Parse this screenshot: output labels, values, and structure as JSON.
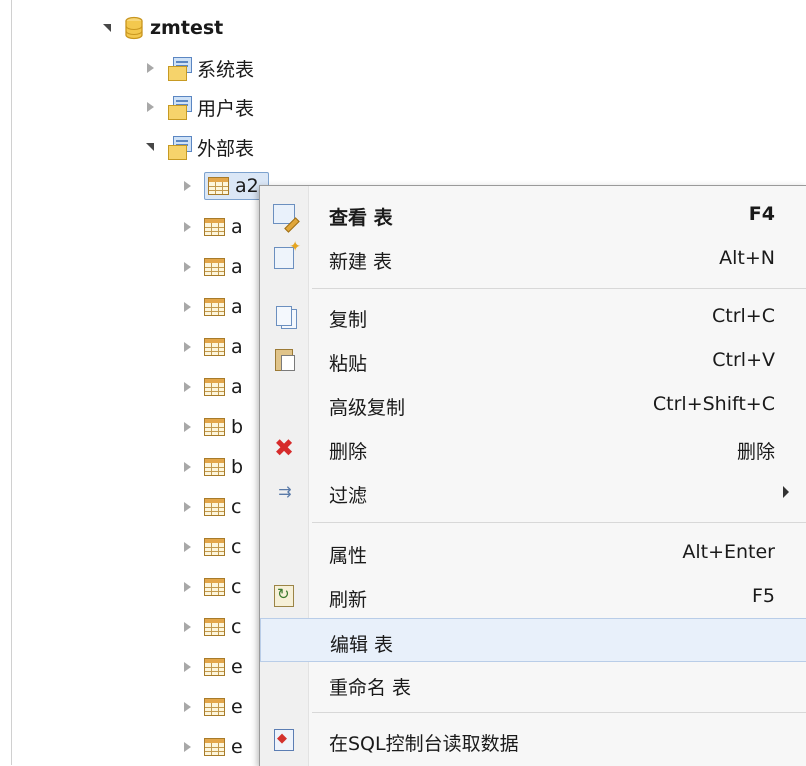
{
  "tree": {
    "database": {
      "label": "zmtest"
    },
    "folders": [
      {
        "label": "系统表",
        "expanded": false
      },
      {
        "label": "用户表",
        "expanded": false
      },
      {
        "label": "外部表",
        "expanded": true
      }
    ],
    "tables": [
      {
        "label": "a2",
        "selected": true
      },
      {
        "label": "a"
      },
      {
        "label": "a"
      },
      {
        "label": "a"
      },
      {
        "label": "a"
      },
      {
        "label": "a"
      },
      {
        "label": "b"
      },
      {
        "label": "b"
      },
      {
        "label": "c"
      },
      {
        "label": "c"
      },
      {
        "label": "c"
      },
      {
        "label": "c"
      },
      {
        "label": "e"
      },
      {
        "label": "e"
      },
      {
        "label": "e"
      }
    ]
  },
  "context_menu": {
    "items": [
      {
        "label": "查看 表",
        "accel": "F4",
        "icon": "view-table-icon"
      },
      {
        "label": "新建 表",
        "accel": "Alt+N",
        "icon": "new-table-icon"
      },
      {
        "label": "复制",
        "accel": "Ctrl+C",
        "icon": "copy-icon"
      },
      {
        "label": "粘贴",
        "accel": "Ctrl+V",
        "icon": "paste-icon"
      },
      {
        "label": "高级复制",
        "accel": "Ctrl+Shift+C",
        "icon": ""
      },
      {
        "label": "删除",
        "accel": "删除",
        "icon": "delete-icon"
      },
      {
        "label": "过滤",
        "accel": "",
        "icon": "filter-icon",
        "submenu": true
      },
      {
        "label": "属性",
        "accel": "Alt+Enter",
        "icon": ""
      },
      {
        "label": "刷新",
        "accel": "F5",
        "icon": "refresh-icon"
      },
      {
        "label": "编辑 表",
        "accel": "",
        "icon": "",
        "hovered": true
      },
      {
        "label": "重命名 表",
        "accel": "",
        "icon": ""
      },
      {
        "label": "在SQL控制台读取数据",
        "accel": "",
        "icon": "sql-console-icon"
      }
    ]
  }
}
